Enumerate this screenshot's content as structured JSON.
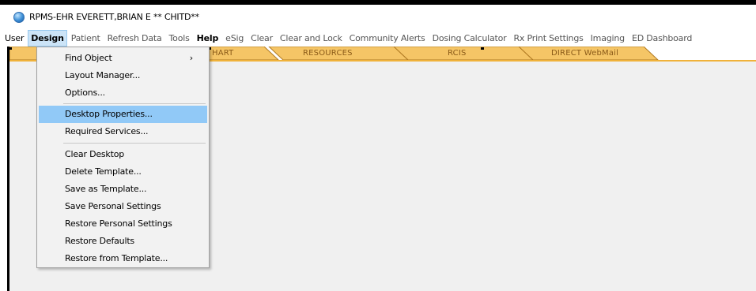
{
  "window": {
    "title": "RPMS-EHR EVERETT,BRIAN E   ** CHITD**"
  },
  "menubar": [
    {
      "label": "User",
      "style": "dark"
    },
    {
      "label": "Design",
      "style": "open"
    },
    {
      "label": "Patient",
      "style": ""
    },
    {
      "label": "Refresh Data",
      "style": ""
    },
    {
      "label": "Tools",
      "style": ""
    },
    {
      "label": "Help",
      "style": "bold"
    },
    {
      "label": "eSig",
      "style": ""
    },
    {
      "label": "Clear",
      "style": ""
    },
    {
      "label": "Clear and Lock",
      "style": ""
    },
    {
      "label": "Community Alerts",
      "style": ""
    },
    {
      "label": "Dosing Calculator",
      "style": ""
    },
    {
      "label": "Rx Print Settings",
      "style": ""
    },
    {
      "label": "Imaging",
      "style": ""
    },
    {
      "label": "ED Dashboard",
      "style": ""
    }
  ],
  "tabs": [
    {
      "label": "HART"
    },
    {
      "label": "RESOURCES"
    },
    {
      "label": "RCIS"
    },
    {
      "label": "DIRECT WebMail"
    }
  ],
  "design_menu": {
    "items": [
      {
        "label": "Find Object",
        "submenu": "›"
      },
      {
        "label": "Layout Manager..."
      },
      {
        "label": "Options..."
      },
      {
        "label": "Desktop Properties...",
        "highlighted": true
      },
      {
        "label": "Required Services..."
      },
      {
        "label": "Clear Desktop"
      },
      {
        "label": "Delete Template..."
      },
      {
        "label": "Save as Template..."
      },
      {
        "label": "Save Personal Settings"
      },
      {
        "label": "Restore Personal Settings"
      },
      {
        "label": "Restore Defaults"
      },
      {
        "label": "Restore from Template..."
      }
    ]
  },
  "colors": {
    "tab_fill": "#f5c566",
    "tab_edge": "#b07a22",
    "menu_highlight": "#91c9f7",
    "workspace": "#f0f0f0"
  },
  "icons": {
    "app": "rpms-globe-icon",
    "submenu": "chevron-right-icon"
  }
}
